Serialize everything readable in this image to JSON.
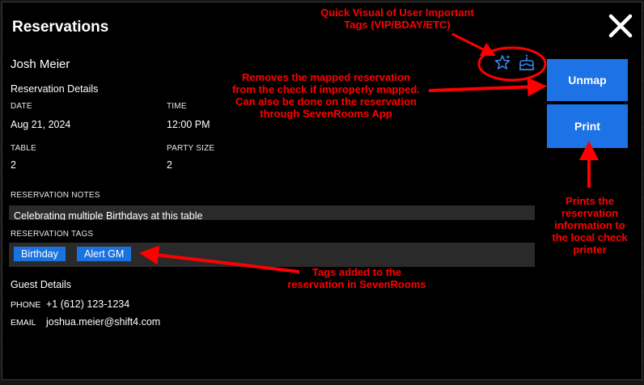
{
  "dialog": {
    "title": "Reservations",
    "guest_name": "Josh Meier",
    "details_heading": "Reservation Details",
    "fields": {
      "date_label": "DATE",
      "date_value": "Aug 21, 2024",
      "time_label": "TIME",
      "time_value": "12:00 PM",
      "table_label": "TABLE",
      "table_value": "2",
      "party_label": "PARTY SIZE",
      "party_value": "2"
    },
    "notes_label": "RESERVATION NOTES",
    "notes_value": "Celebrating multiple Birthdays at this table",
    "tags_label": "RESERVATION TAGS",
    "tags": [
      "Birthday",
      "Alert GM"
    ],
    "guest_heading": "Guest Details",
    "phone_label": "PHONE",
    "phone_value": "+1 (612) 123-1234",
    "email_label": "EMAIL",
    "email_value": "joshua.meier@shift4.com",
    "buttons": {
      "unmap": "Unmap",
      "print": "Print"
    },
    "icons": [
      "star-vip-icon",
      "birthday-cake-icon"
    ],
    "accent_color": "#1d72e6"
  },
  "annotations": {
    "tags_visual_1": "Quick Visual of User Important",
    "tags_visual_2": "Tags (VIP/BDAY/ETC)",
    "unmap_1": "Removes the mapped reservation",
    "unmap_2": "from the check if improperly mapped.",
    "unmap_3": "Can also be done on the reservation",
    "unmap_4": "through SevenRooms App",
    "print_1": "Prints the",
    "print_2": "reservation",
    "print_3": "information to",
    "print_4": "the local check",
    "print_5": "printer",
    "tags_1": "Tags added to the",
    "tags_2": "reservation in SevenRooms",
    "color": "#ff0000"
  }
}
